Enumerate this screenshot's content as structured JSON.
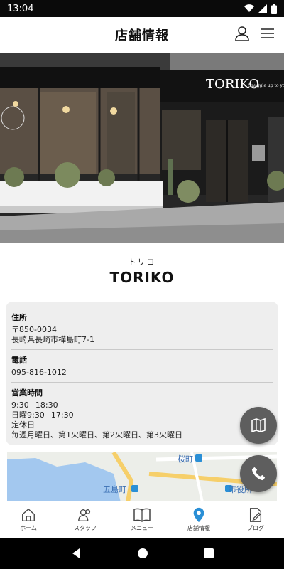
{
  "status_bar": {
    "time": "13:04"
  },
  "header": {
    "title": "店舗情報"
  },
  "hero": {
    "sign_text": "TORIKO",
    "sign_sub": "Snuggle up to your LIFE",
    "glass_logo_sub": "Snuggle up to your LIFE"
  },
  "shop": {
    "furigana": "トリコ",
    "name": "TORIKO"
  },
  "info": {
    "address": {
      "label": "住所",
      "lines": [
        "〒850-0034",
        "長崎県長崎市樺島町7-1"
      ]
    },
    "phone": {
      "label": "電話",
      "lines": [
        "095-816-1012"
      ]
    },
    "hours": {
      "label": "営業時間",
      "lines": [
        "9:30−18:30",
        "日曜9:30−17:30",
        "定休日",
        "毎週月曜日、第1火曜日、第2火曜日、第3火曜日"
      ]
    }
  },
  "map": {
    "labels": {
      "sakuramachi": "桜町",
      "gotomachi": "五島町",
      "shiyakusho": "市役所"
    }
  },
  "tabs": [
    {
      "label": "ホーム",
      "icon": "home-icon"
    },
    {
      "label": "スタッフ",
      "icon": "staff-icon"
    },
    {
      "label": "メニュー",
      "icon": "menu-book-icon"
    },
    {
      "label": "店舗情報",
      "icon": "location-pin-icon"
    },
    {
      "label": "ブログ",
      "icon": "blog-icon"
    }
  ],
  "colors": {
    "accent": "#2a8fd6",
    "fab": "#5e5e5e"
  }
}
